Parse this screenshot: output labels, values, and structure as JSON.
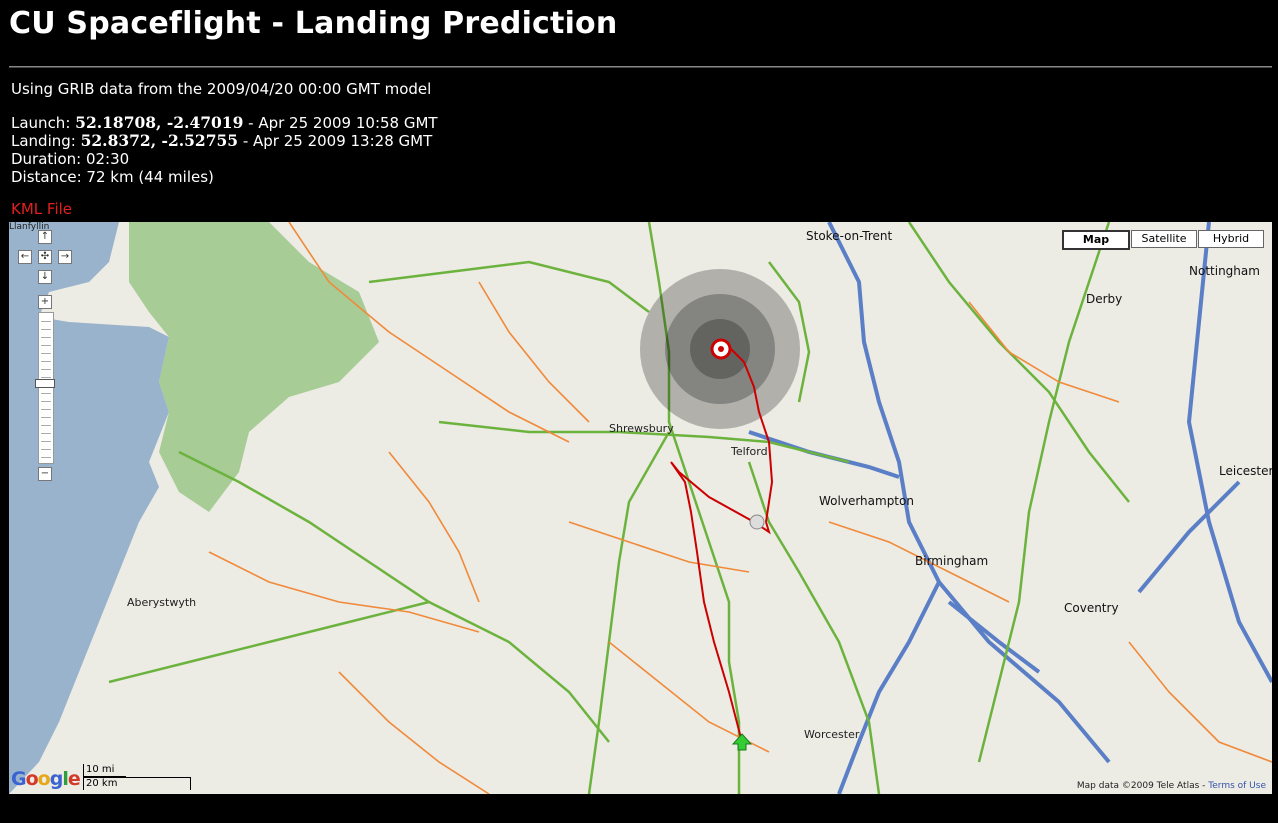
{
  "page": {
    "title": "CU Spaceflight - Landing Prediction",
    "grib_line": "Using GRIB data from the 2009/04/20 00:00 GMT model",
    "launch": {
      "label": "Launch:",
      "coords": "52.18708, -2.47019",
      "time": " - Apr 25 2009 10:58 GMT"
    },
    "landing": {
      "label": "Landing:",
      "coords": "52.8372, -2.52755",
      "time": " - Apr 25 2009 13:28 GMT"
    },
    "duration": "Duration: 02:30",
    "distance": "Distance: 72 km (44 miles)",
    "kml_link": "KML File"
  },
  "map": {
    "map_types": [
      {
        "label": "Map",
        "selected": true
      },
      {
        "label": "Satellite",
        "selected": false
      },
      {
        "label": "Hybrid",
        "selected": false
      }
    ],
    "logo": "Google",
    "scale": {
      "upper": "10 mi",
      "lower": "20 km"
    },
    "copyright": "Map data ©2009 Tele Atlas",
    "terms": "Terms of Use",
    "colors": {
      "sea": "#99b3cc",
      "land": "#ecebe4",
      "park": "#a7cc95",
      "route": "#cc0000",
      "motorway": "#5b7fc6",
      "a_road": "#7cc042"
    },
    "towns": [
      {
        "name": "Llanfyllin",
        "t": "Llanfyllin"
      },
      {
        "name": "Stoke-on-Trent",
        "t": "Stoke-on-Trent"
      },
      {
        "name": "Nottingham",
        "t": "Nottingham"
      },
      {
        "name": "Shrewsbury",
        "t": "Shrewsbury"
      },
      {
        "name": "Telford",
        "t": "Telford"
      },
      {
        "name": "Wolverhampton",
        "t": "Wolverhampton"
      },
      {
        "name": "Birmingham",
        "t": "Birmingham"
      },
      {
        "name": "Coventry",
        "t": "Coventry"
      },
      {
        "name": "Worcester",
        "t": "Worcester"
      },
      {
        "name": "Aberystwyth",
        "t": "Aberystwyth"
      },
      {
        "name": "Derby",
        "t": "Derby"
      },
      {
        "name": "Leicester",
        "t": "Leicester"
      }
    ]
  }
}
